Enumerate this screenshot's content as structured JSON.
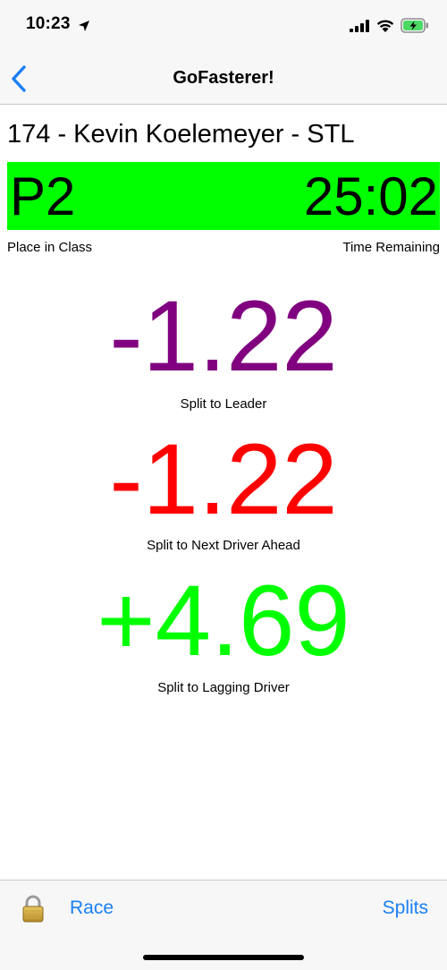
{
  "status_bar": {
    "time": "10:23"
  },
  "nav": {
    "title": "GoFasterer!"
  },
  "driver": {
    "title": "174 - Kevin Koelemeyer - STL"
  },
  "banner": {
    "place": "P2",
    "time_remaining": "25:02",
    "place_label": "Place in Class",
    "time_label": "Time Remaining",
    "color": "#00ff00"
  },
  "splits": [
    {
      "value": "-1.22",
      "label": "Split to Leader",
      "color": "#800080"
    },
    {
      "value": "-1.22",
      "label": "Split to Next Driver Ahead",
      "color": "#ff0000"
    },
    {
      "value": "+4.69",
      "label": "Split to Lagging Driver",
      "color": "#00ff00"
    }
  ],
  "tab_bar": {
    "race_label": "Race",
    "splits_label": "Splits",
    "lock_icon": "lock-icon"
  },
  "colors": {
    "accent": "#1a7ff5"
  }
}
